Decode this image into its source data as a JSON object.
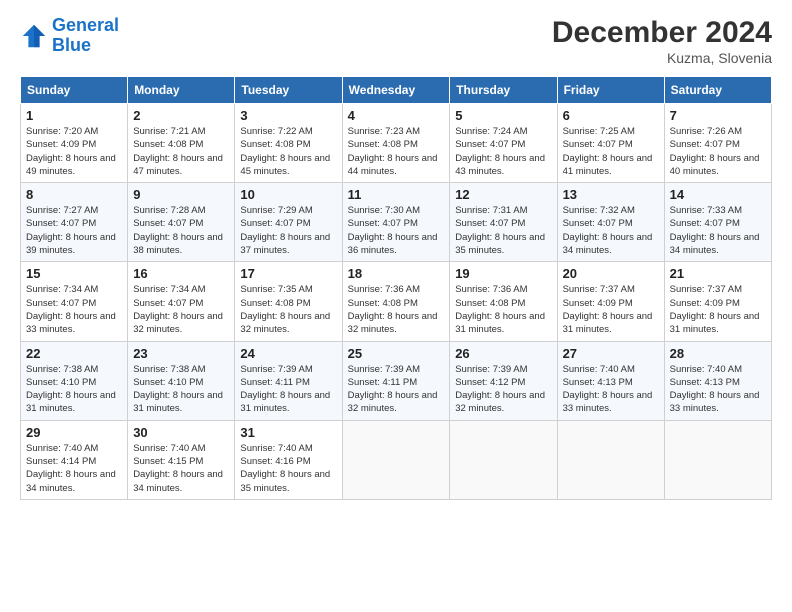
{
  "logo": {
    "text_general": "General",
    "text_blue": "Blue"
  },
  "header": {
    "month": "December 2024",
    "location": "Kuzma, Slovenia"
  },
  "weekdays": [
    "Sunday",
    "Monday",
    "Tuesday",
    "Wednesday",
    "Thursday",
    "Friday",
    "Saturday"
  ],
  "weeks": [
    [
      {
        "day": "1",
        "sunrise": "7:20 AM",
        "sunset": "4:09 PM",
        "daylight": "8 hours and 49 minutes."
      },
      {
        "day": "2",
        "sunrise": "7:21 AM",
        "sunset": "4:08 PM",
        "daylight": "8 hours and 47 minutes."
      },
      {
        "day": "3",
        "sunrise": "7:22 AM",
        "sunset": "4:08 PM",
        "daylight": "8 hours and 45 minutes."
      },
      {
        "day": "4",
        "sunrise": "7:23 AM",
        "sunset": "4:08 PM",
        "daylight": "8 hours and 44 minutes."
      },
      {
        "day": "5",
        "sunrise": "7:24 AM",
        "sunset": "4:07 PM",
        "daylight": "8 hours and 43 minutes."
      },
      {
        "day": "6",
        "sunrise": "7:25 AM",
        "sunset": "4:07 PM",
        "daylight": "8 hours and 41 minutes."
      },
      {
        "day": "7",
        "sunrise": "7:26 AM",
        "sunset": "4:07 PM",
        "daylight": "8 hours and 40 minutes."
      }
    ],
    [
      {
        "day": "8",
        "sunrise": "7:27 AM",
        "sunset": "4:07 PM",
        "daylight": "8 hours and 39 minutes."
      },
      {
        "day": "9",
        "sunrise": "7:28 AM",
        "sunset": "4:07 PM",
        "daylight": "8 hours and 38 minutes."
      },
      {
        "day": "10",
        "sunrise": "7:29 AM",
        "sunset": "4:07 PM",
        "daylight": "8 hours and 37 minutes."
      },
      {
        "day": "11",
        "sunrise": "7:30 AM",
        "sunset": "4:07 PM",
        "daylight": "8 hours and 36 minutes."
      },
      {
        "day": "12",
        "sunrise": "7:31 AM",
        "sunset": "4:07 PM",
        "daylight": "8 hours and 35 minutes."
      },
      {
        "day": "13",
        "sunrise": "7:32 AM",
        "sunset": "4:07 PM",
        "daylight": "8 hours and 34 minutes."
      },
      {
        "day": "14",
        "sunrise": "7:33 AM",
        "sunset": "4:07 PM",
        "daylight": "8 hours and 34 minutes."
      }
    ],
    [
      {
        "day": "15",
        "sunrise": "7:34 AM",
        "sunset": "4:07 PM",
        "daylight": "8 hours and 33 minutes."
      },
      {
        "day": "16",
        "sunrise": "7:34 AM",
        "sunset": "4:07 PM",
        "daylight": "8 hours and 32 minutes."
      },
      {
        "day": "17",
        "sunrise": "7:35 AM",
        "sunset": "4:08 PM",
        "daylight": "8 hours and 32 minutes."
      },
      {
        "day": "18",
        "sunrise": "7:36 AM",
        "sunset": "4:08 PM",
        "daylight": "8 hours and 32 minutes."
      },
      {
        "day": "19",
        "sunrise": "7:36 AM",
        "sunset": "4:08 PM",
        "daylight": "8 hours and 31 minutes."
      },
      {
        "day": "20",
        "sunrise": "7:37 AM",
        "sunset": "4:09 PM",
        "daylight": "8 hours and 31 minutes."
      },
      {
        "day": "21",
        "sunrise": "7:37 AM",
        "sunset": "4:09 PM",
        "daylight": "8 hours and 31 minutes."
      }
    ],
    [
      {
        "day": "22",
        "sunrise": "7:38 AM",
        "sunset": "4:10 PM",
        "daylight": "8 hours and 31 minutes."
      },
      {
        "day": "23",
        "sunrise": "7:38 AM",
        "sunset": "4:10 PM",
        "daylight": "8 hours and 31 minutes."
      },
      {
        "day": "24",
        "sunrise": "7:39 AM",
        "sunset": "4:11 PM",
        "daylight": "8 hours and 31 minutes."
      },
      {
        "day": "25",
        "sunrise": "7:39 AM",
        "sunset": "4:11 PM",
        "daylight": "8 hours and 32 minutes."
      },
      {
        "day": "26",
        "sunrise": "7:39 AM",
        "sunset": "4:12 PM",
        "daylight": "8 hours and 32 minutes."
      },
      {
        "day": "27",
        "sunrise": "7:40 AM",
        "sunset": "4:13 PM",
        "daylight": "8 hours and 33 minutes."
      },
      {
        "day": "28",
        "sunrise": "7:40 AM",
        "sunset": "4:13 PM",
        "daylight": "8 hours and 33 minutes."
      }
    ],
    [
      {
        "day": "29",
        "sunrise": "7:40 AM",
        "sunset": "4:14 PM",
        "daylight": "8 hours and 34 minutes."
      },
      {
        "day": "30",
        "sunrise": "7:40 AM",
        "sunset": "4:15 PM",
        "daylight": "8 hours and 34 minutes."
      },
      {
        "day": "31",
        "sunrise": "7:40 AM",
        "sunset": "4:16 PM",
        "daylight": "8 hours and 35 minutes."
      },
      null,
      null,
      null,
      null
    ]
  ]
}
